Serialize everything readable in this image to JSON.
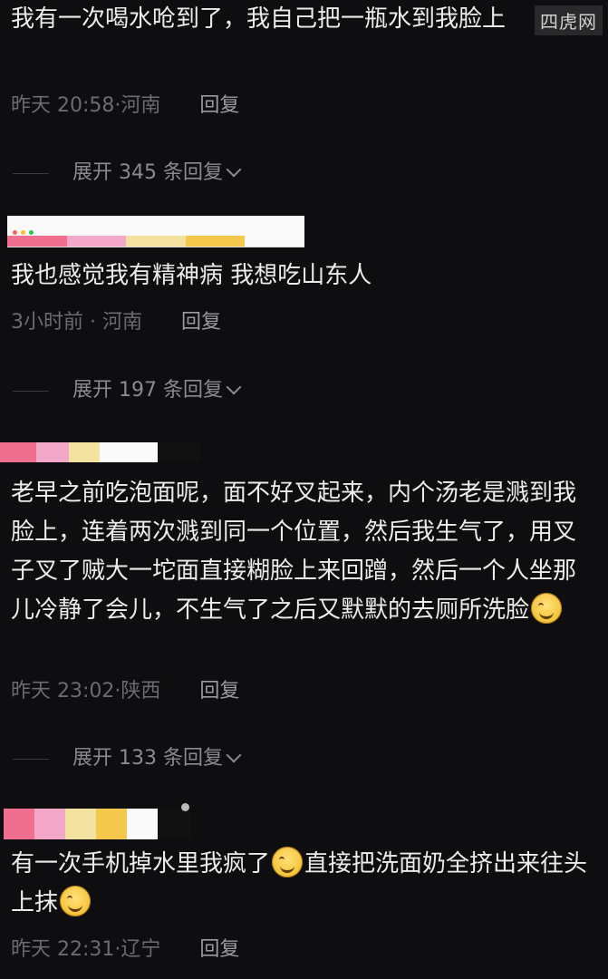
{
  "watermark": "四虎网",
  "comments": [
    {
      "text": "我有一次喝水呛到了，我自己把一瓶水到我脸上",
      "time": "昨天 20:58",
      "location": "河南",
      "reply_label": "回复",
      "expand_label": "展开 345 条回复"
    },
    {
      "text": "我也感觉我有精神病 我想吃山东人",
      "time": "3小时前",
      "location": "河南",
      "reply_label": "回复",
      "expand_label": "展开 197 条回复"
    },
    {
      "text": "老早之前吃泡面呢，面不好叉起来，内个汤老是溅到我脸上，连着两次溅到同一个位置，然后我生气了，用叉子叉了贼大一坨面直接糊脸上来回蹭，然后一个人坐那儿冷静了会儿，不生气了之后又默默的去厕所洗脸",
      "time": "昨天 23:02",
      "location": "陕西",
      "reply_label": "回复",
      "expand_label": "展开 133 条回复"
    },
    {
      "text_part1": "有一次手机掉水里我疯了",
      "text_part2": "直接把洗面奶全挤出来往头上抹",
      "time": "昨天 22:31",
      "location": "辽宁",
      "reply_label": "回复"
    }
  ],
  "colors": {
    "background": "#0e0e10",
    "text": "#ececec",
    "meta": "#6b6b70",
    "strip": [
      "#f06f8e",
      "#f3a7c9",
      "#f4e3a0",
      "#f2c94c",
      "#fafafa"
    ]
  },
  "icons": [
    "chevron-down-icon",
    "grinning-sweat-emoji-icon",
    "smiling-emoji-icon"
  ]
}
